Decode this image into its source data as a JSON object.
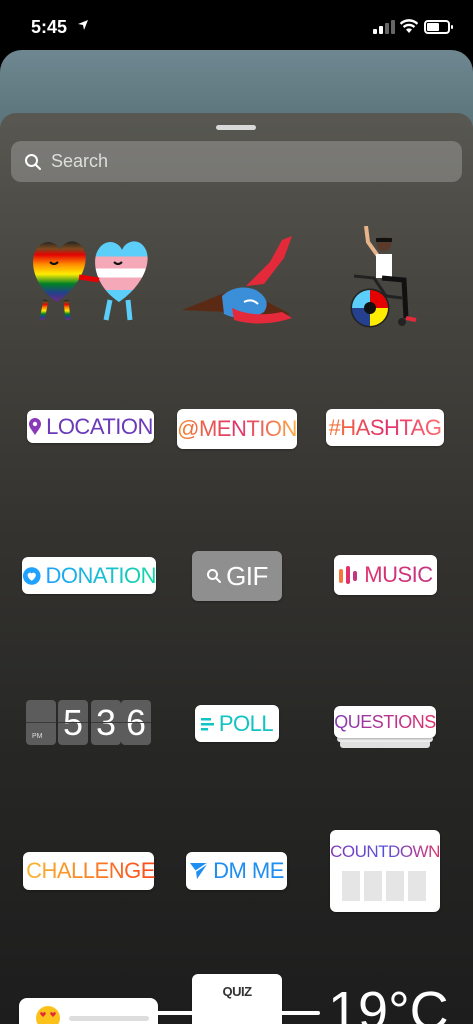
{
  "status_bar": {
    "time": "5:45"
  },
  "search": {
    "placeholder": "Search"
  },
  "stickers": {
    "location": "LOCATION",
    "mention": "@MENTION",
    "hashtag": "#HASHTAG",
    "donation": "DONATION",
    "gif": "GIF",
    "music": "MUSIC",
    "time_digits": [
      "5",
      "3",
      "6"
    ],
    "time_ampm": "PM",
    "poll": "POLL",
    "questions": "QUESTIONS",
    "challenge": "CHALLENGE",
    "dm_me": "DM ME",
    "countdown": "COUNTDOWN",
    "quiz": "QUIZ",
    "temperature": "19°C"
  },
  "colors": {
    "location": "#8a3ab9",
    "poll": "#12c3c3",
    "dm_me": "#1f8ef1",
    "gif_bg": "#8f8f8f"
  }
}
